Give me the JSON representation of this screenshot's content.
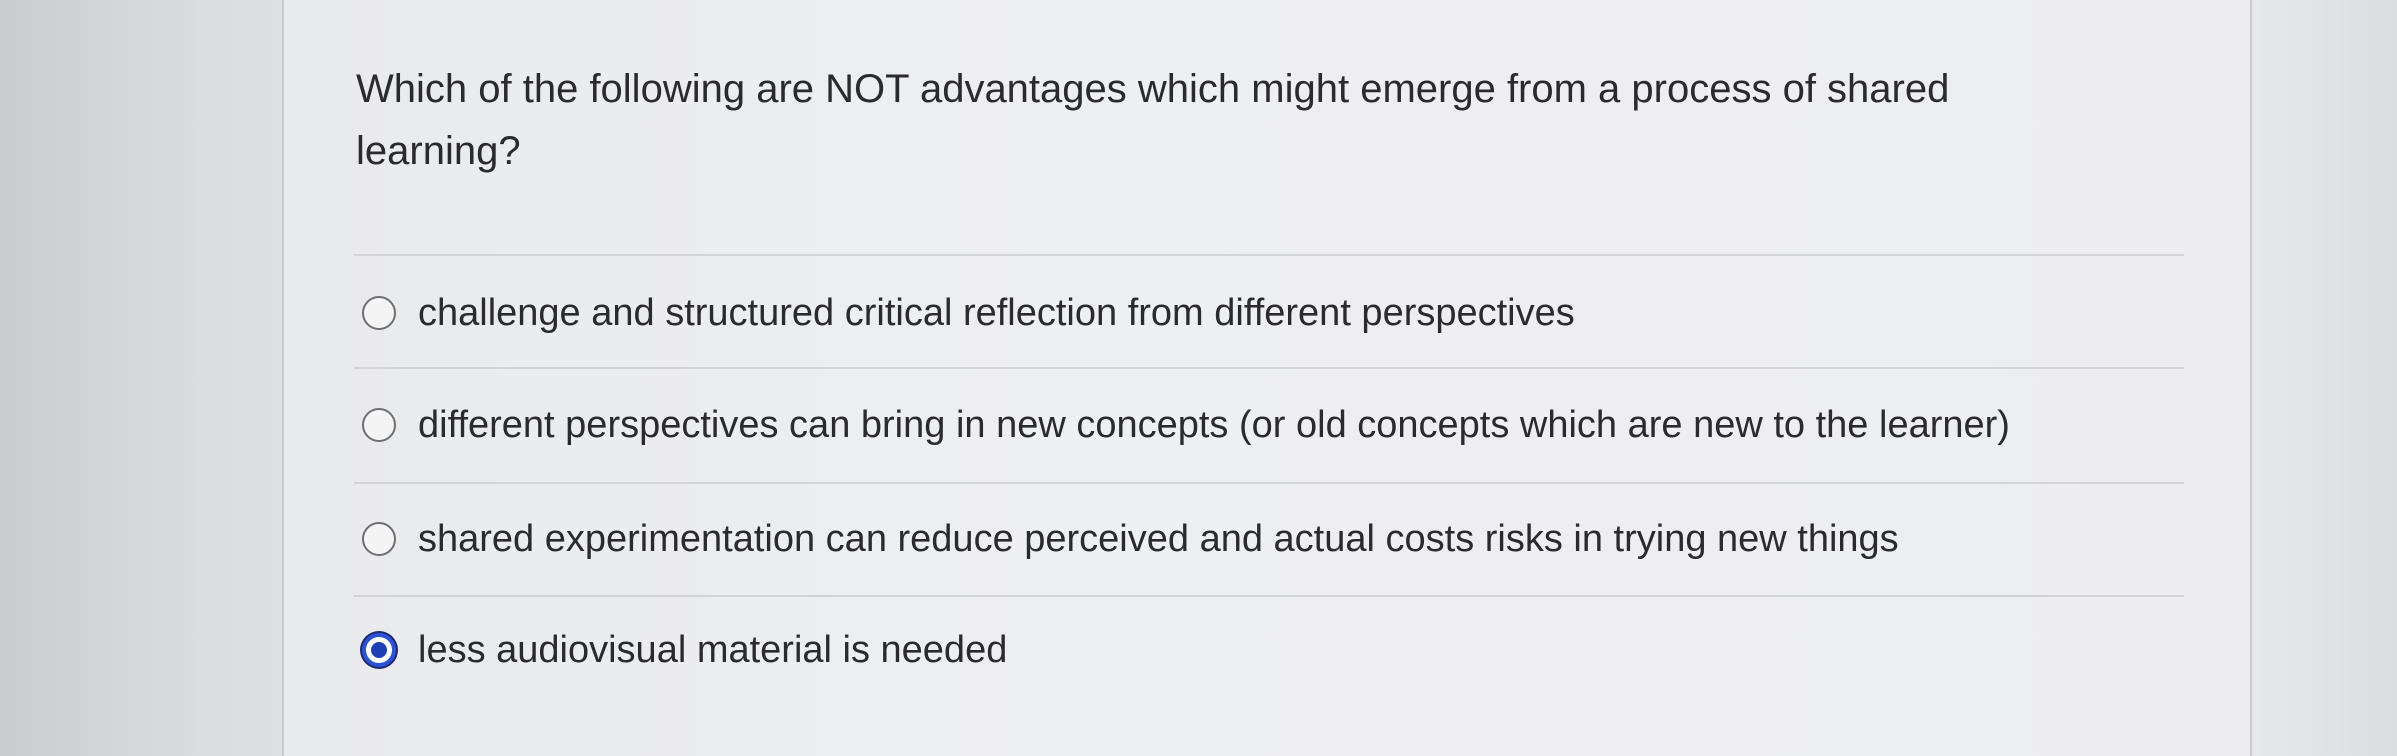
{
  "question": {
    "text": "Which of the following are NOT advantages which might emerge from a process of shared learning?"
  },
  "options": [
    {
      "label": "challenge and structured critical reflection from different perspectives",
      "selected": false
    },
    {
      "label": "different perspectives can bring in new concepts (or old concepts which are new to the learner)",
      "selected": false
    },
    {
      "label": "shared experimentation can reduce perceived and actual costs risks in trying new things",
      "selected": false
    },
    {
      "label": "less audiovisual material is needed",
      "selected": true
    }
  ],
  "colors": {
    "selected_radio": "#2a53d8",
    "text": "#2b2b2d"
  }
}
